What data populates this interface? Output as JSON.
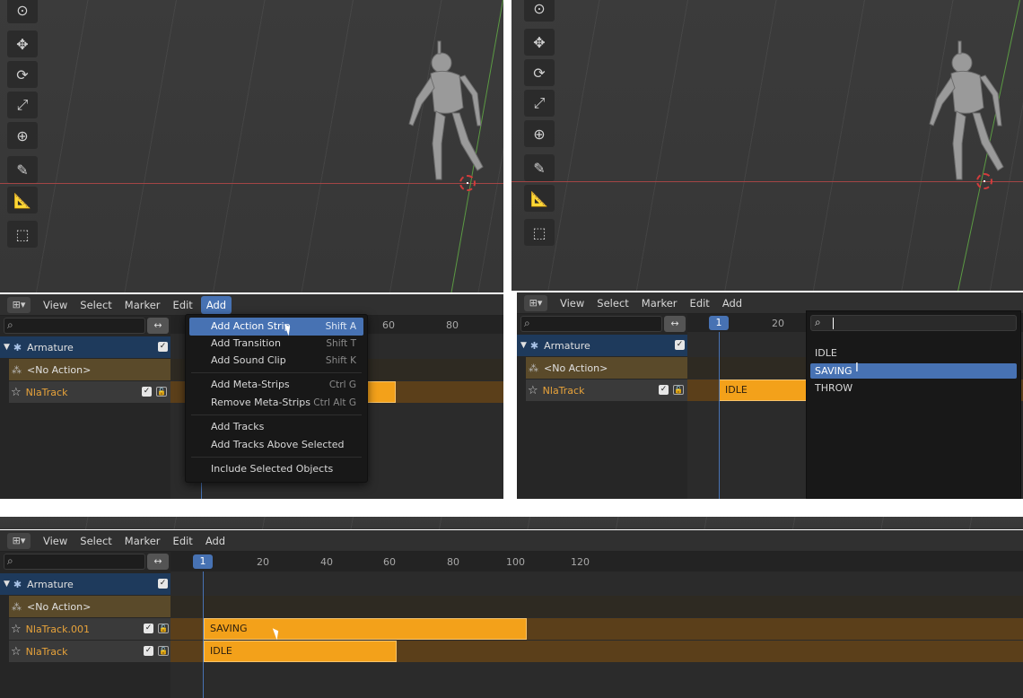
{
  "panels": {
    "top_left": {
      "menu": [
        "View",
        "Select",
        "Marker",
        "Edit",
        "Add"
      ],
      "active_menu": "Add",
      "ruler_ticks": [
        "60",
        "80"
      ],
      "channels": {
        "armature": "Armature",
        "no_action": "<No Action>",
        "track": "NlaTrack"
      },
      "add_menu": [
        {
          "label": "Add Action Strip",
          "shortcut": "Shift A",
          "selected": true
        },
        {
          "label": "Add Transition",
          "shortcut": "Shift T"
        },
        {
          "label": "Add Sound Clip",
          "shortcut": "Shift K"
        },
        {
          "label": "Add Meta-Strips",
          "shortcut": "Ctrl G"
        },
        {
          "label": "Remove Meta-Strips",
          "shortcut": "Ctrl Alt G"
        },
        {
          "label": "Add Tracks",
          "shortcut": ""
        },
        {
          "label": "Add Tracks Above Selected",
          "shortcut": ""
        },
        {
          "label": "Include Selected Objects",
          "shortcut": ""
        }
      ]
    },
    "top_right": {
      "menu": [
        "View",
        "Select",
        "Marker",
        "Edit",
        "Add"
      ],
      "current_frame": "1",
      "ruler_ticks": [
        "20"
      ],
      "channels": {
        "armature": "Armature",
        "no_action": "<No Action>",
        "track": "NlaTrack"
      },
      "strip_label": "IDLE",
      "search_value": "",
      "actions": [
        "IDLE",
        "SAVING",
        "THROW"
      ],
      "selected_action": "SAVING"
    },
    "bottom": {
      "menu": [
        "View",
        "Select",
        "Marker",
        "Edit",
        "Add"
      ],
      "current_frame": "1",
      "ruler_ticks": [
        "20",
        "40",
        "60",
        "80",
        "100",
        "120"
      ],
      "channels": {
        "armature": "Armature",
        "no_action": "<No Action>",
        "track_1": "NlaTrack.001",
        "track_0": "NlaTrack"
      },
      "strips": {
        "saving": "SAVING",
        "idle": "IDLE"
      }
    }
  },
  "icons": {
    "editor_type": "nla-editor-icon",
    "search": "search-icon",
    "swap": "swap-icon"
  },
  "colors": {
    "accent": "#4772b3",
    "strip": "#f3a11a",
    "track_text": "#e8a33a"
  }
}
